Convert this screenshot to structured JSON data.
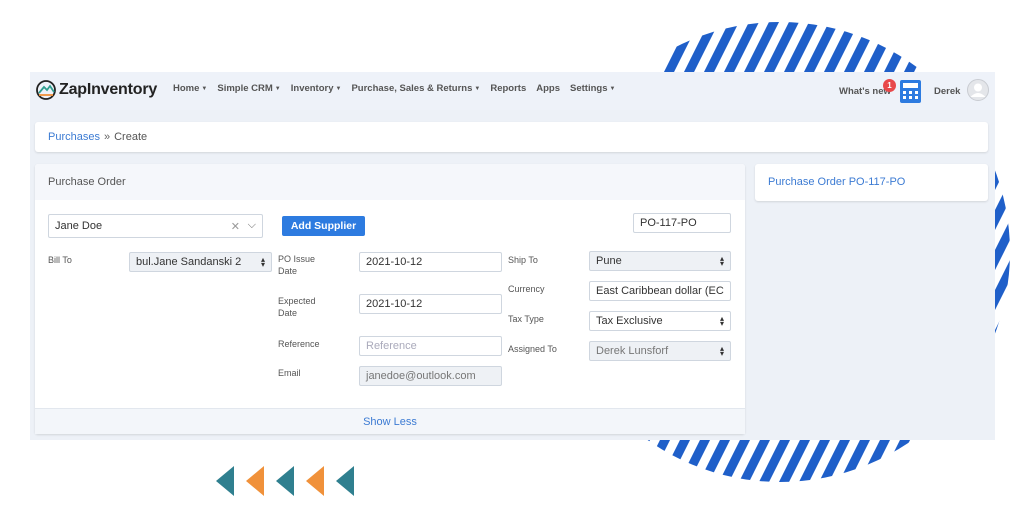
{
  "brand": {
    "name": "ZapInventory"
  },
  "nav": {
    "items": [
      {
        "label": "Home",
        "caret": true
      },
      {
        "label": "Simple CRM",
        "caret": true
      },
      {
        "label": "Inventory",
        "caret": true
      },
      {
        "label": "Purchase, Sales & Returns",
        "caret": true
      },
      {
        "label": "Reports",
        "caret": false
      },
      {
        "label": "Apps",
        "caret": false
      },
      {
        "label": "Settings",
        "caret": true
      }
    ],
    "whats_new": "What's new",
    "notification_count": "1",
    "user": "Derek"
  },
  "breadcrumb": {
    "parent": "Purchases",
    "separator": "»",
    "current": "Create"
  },
  "form": {
    "title": "Purchase Order",
    "supplier": {
      "value": "Jane Doe"
    },
    "add_supplier_label": "Add Supplier",
    "po_number": "PO-117-PO",
    "bill_to": {
      "label": "Bill To",
      "value": "bul.Jane Sandanski 2"
    },
    "po_issue_date": {
      "label_1": "PO Issue",
      "label_2": "Date",
      "value": "2021-10-12"
    },
    "expected_date": {
      "label_1": "Expected",
      "label_2": "Date",
      "value": "2021-10-12"
    },
    "reference": {
      "label": "Reference",
      "placeholder": "Reference"
    },
    "email": {
      "label": "Email",
      "value": "janedoe@outlook.com"
    },
    "ship_to": {
      "label": "Ship To",
      "value": "Pune"
    },
    "currency": {
      "label": "Currency",
      "value": "East Caribbean dollar (EC"
    },
    "tax_type": {
      "label": "Tax Type",
      "value": "Tax Exclusive"
    },
    "assigned_to": {
      "label": "Assigned To",
      "value": "Derek Lunsforf"
    },
    "show_less": "Show Less"
  },
  "side": {
    "title": "Purchase Order PO-117-PO"
  },
  "colors": {
    "primary": "#2d7be0",
    "link": "#3c7bd3",
    "stripe": "#1f5fc9",
    "arrow_teal": "#2f7f8f",
    "arrow_orange": "#f0913a",
    "badge": "#e8484a"
  }
}
